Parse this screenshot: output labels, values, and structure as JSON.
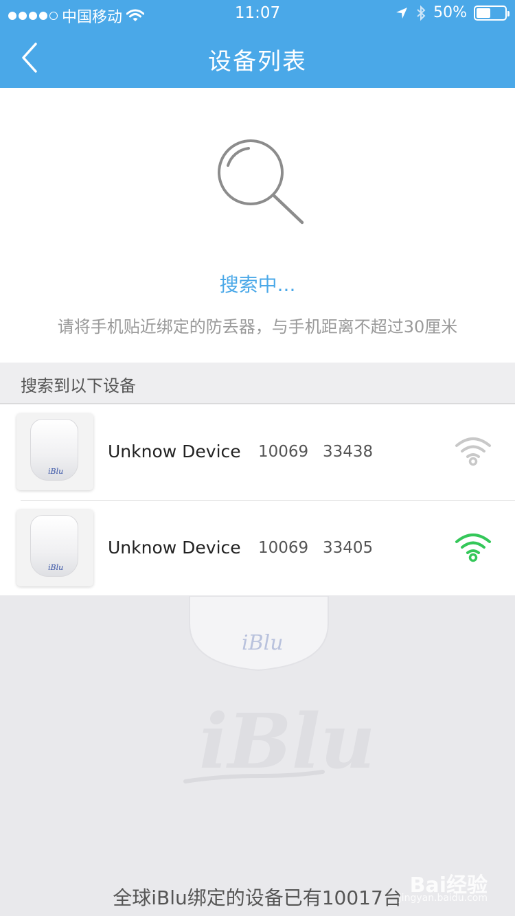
{
  "status_bar": {
    "carrier": "中国移动",
    "time": "11:07",
    "battery": "50%",
    "battery_level": 0.5,
    "signal_bars_filled": 4,
    "signal_bars_total": 5
  },
  "navbar": {
    "title": "设备列表",
    "back_icon": "chevron-left-icon"
  },
  "search": {
    "icon": "search-icon",
    "status": "搜索中...",
    "hint": "请将手机贴近绑定的防丢器，与手机距离不超过30厘米"
  },
  "list": {
    "header": "搜索到以下设备",
    "devices": [
      {
        "name": "Unknow Device",
        "id1": "10069",
        "id2": "33438",
        "signal": "weak",
        "signal_color": "#c8c8c8"
      },
      {
        "name": "Unknow Device",
        "id1": "10069",
        "id2": "33405",
        "signal": "strong",
        "signal_color": "#34c759"
      }
    ]
  },
  "footer": {
    "text": "全球iBlu绑定的设备已有10017台"
  },
  "watermark": {
    "text": "Bai经验",
    "sub": "jingyan.baidu.com"
  },
  "colors": {
    "accent": "#4aa8e8",
    "page_bg": "#e9e9ec"
  }
}
